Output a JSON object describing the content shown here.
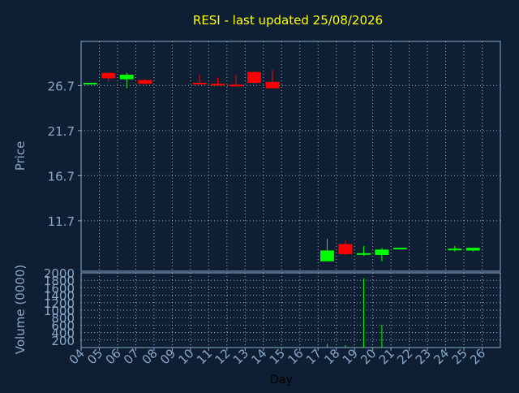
{
  "colors": {
    "background": "#0f1f33",
    "axis_text": "#8aa8c8",
    "title": "#ffff00",
    "grid": "#c8d2dc",
    "up": "#00ff00",
    "down": "#ff0000",
    "volume": "#00ff00",
    "xlabel": "#000000"
  },
  "chart_data": [
    {
      "type": "candlestick",
      "title": "RESI - last updated 25/08/2026",
      "ylabel": "Price",
      "categories": [
        "04",
        "05",
        "06",
        "07",
        "08",
        "09",
        "10",
        "11",
        "12",
        "13",
        "14",
        "15",
        "16",
        "17",
        "18",
        "19",
        "20",
        "21",
        "22",
        "23",
        "24",
        "25",
        "26"
      ],
      "yticks": [
        "26.7",
        "21.7",
        "16.7",
        "11.7"
      ],
      "ytick_values": [
        26.7,
        21.7,
        16.7,
        11.7
      ],
      "ylim": [
        6.1,
        31.6
      ],
      "grid": true,
      "series": [
        {
          "x": "04",
          "open": 27.0,
          "high": 27.0,
          "low": 27.0,
          "close": 27.0
        },
        {
          "x": "05",
          "open": 28.1,
          "high": 28.2,
          "low": 27.1,
          "close": 27.5
        },
        {
          "x": "06",
          "open": 27.4,
          "high": 28.1,
          "low": 26.4,
          "close": 27.9
        },
        {
          "x": "07",
          "open": 27.3,
          "high": 27.4,
          "low": 26.8,
          "close": 26.9
        },
        {
          "x": "10",
          "open": 27.0,
          "high": 27.9,
          "low": 26.9,
          "close": 26.9
        },
        {
          "x": "11",
          "open": 26.9,
          "high": 27.6,
          "low": 26.7,
          "close": 26.7
        },
        {
          "x": "12",
          "open": 26.8,
          "high": 27.9,
          "low": 26.6,
          "close": 26.7
        },
        {
          "x": "13",
          "open": 28.2,
          "high": 28.3,
          "low": 26.9,
          "close": 27.0
        },
        {
          "x": "14",
          "open": 27.1,
          "high": 28.4,
          "low": 26.4,
          "close": 26.4
        },
        {
          "x": "17",
          "open": 7.2,
          "high": 9.7,
          "low": 7.2,
          "close": 8.4
        },
        {
          "x": "18",
          "open": 9.1,
          "high": 9.5,
          "low": 7.9,
          "close": 8.0
        },
        {
          "x": "19",
          "open": 8.0,
          "high": 8.9,
          "low": 7.8,
          "close": 8.1
        },
        {
          "x": "20",
          "open": 7.9,
          "high": 8.7,
          "low": 7.2,
          "close": 8.5
        },
        {
          "x": "21",
          "open": 8.6,
          "high": 8.7,
          "low": 8.5,
          "close": 8.7
        },
        {
          "x": "24",
          "open": 8.5,
          "high": 8.9,
          "low": 8.3,
          "close": 8.6
        },
        {
          "x": "25",
          "open": 8.4,
          "high": 8.7,
          "low": 8.3,
          "close": 8.7
        }
      ]
    },
    {
      "type": "bar",
      "ylabel": "Volume (0000)",
      "xlabel": "Day",
      "categories": [
        "04",
        "05",
        "06",
        "07",
        "08",
        "09",
        "10",
        "11",
        "12",
        "13",
        "14",
        "15",
        "16",
        "17",
        "18",
        "19",
        "20",
        "21",
        "22",
        "23",
        "24",
        "25",
        "26"
      ],
      "yticks": [
        "2000",
        "1800",
        "1600",
        "1400",
        "1200",
        "1000",
        "800",
        "600",
        "400",
        "200"
      ],
      "ytick_values": [
        2000,
        1800,
        1600,
        1400,
        1200,
        1000,
        800,
        600,
        400,
        200
      ],
      "ylim": [
        0,
        2000
      ],
      "grid": true,
      "series": [
        {
          "x": "04",
          "value": 10
        },
        {
          "x": "05",
          "value": 10
        },
        {
          "x": "06",
          "value": 10
        },
        {
          "x": "07",
          "value": 10
        },
        {
          "x": "10",
          "value": 10
        },
        {
          "x": "11",
          "value": 10
        },
        {
          "x": "12",
          "value": 10
        },
        {
          "x": "13",
          "value": 15
        },
        {
          "x": "14",
          "value": 20
        },
        {
          "x": "17",
          "value": 100
        },
        {
          "x": "18",
          "value": 60
        },
        {
          "x": "19",
          "value": 1850
        },
        {
          "x": "20",
          "value": 600
        },
        {
          "x": "21",
          "value": 15
        },
        {
          "x": "24",
          "value": 10
        },
        {
          "x": "25",
          "value": 10
        }
      ]
    }
  ]
}
